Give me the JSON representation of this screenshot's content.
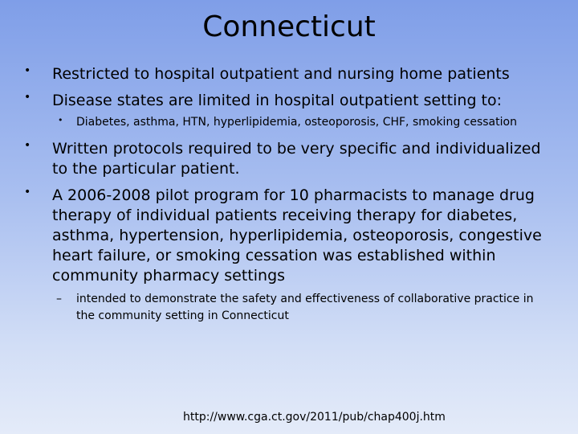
{
  "slide": {
    "title": "Connecticut",
    "bullets": [
      {
        "marker": "•",
        "text": "Restricted to hospital outpatient and nursing home patients"
      },
      {
        "marker": "•",
        "text": "Disease states are limited in hospital outpatient setting to:"
      },
      {
        "marker": "•",
        "text": "Diabetes, asthma, HTN, hyperlipidemia, osteoporosis, CHF, smoking cessation"
      },
      {
        "marker": "•",
        "text": "Written protocols required to be very specific and individualized to the particular patient."
      },
      {
        "marker": "•",
        "text": "A 2006-2008 pilot program for 10 pharmacists to manage drug therapy of individual patients receiving therapy for diabetes, asthma, hypertension, hyperlipidemia, osteoporosis, congestive heart failure, or smoking cessation was established within community pharmacy settings"
      },
      {
        "marker": "–",
        "text": " intended to demonstrate the safety and effectiveness of collaborative practice in the community setting in Connecticut"
      }
    ],
    "source_url": "http://www.cga.ct.gov/2011/pub/chap400j.htm"
  }
}
